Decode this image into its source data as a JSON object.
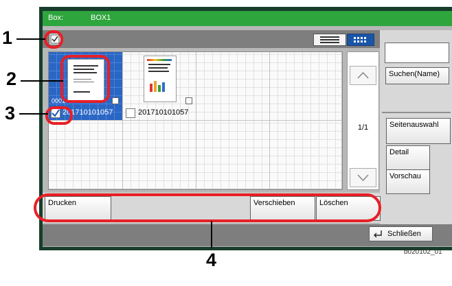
{
  "header": {
    "box_label": "Box:",
    "box_name": "BOX1"
  },
  "files": [
    {
      "name": "201710101057",
      "selected": true,
      "id_prefix": "0001"
    },
    {
      "name": "201710101057",
      "selected": false
    }
  ],
  "pagination": {
    "indicator": "1/1"
  },
  "right_panel": {
    "search_name": "Suchen(Name)",
    "page_selection": "Seitenauswahl",
    "detail": "Detail",
    "preview": "Vorschau"
  },
  "actions": {
    "print": "Drucken",
    "move": "Verschieben",
    "delete": "Löschen"
  },
  "footer": {
    "close": "Schließen",
    "figure_ref": "b020102_01"
  },
  "callouts": [
    "1",
    "2",
    "3",
    "4"
  ],
  "colors": {
    "header": "#2fa53d",
    "selection": "#2a66c4",
    "callout_ring": "#e81f26",
    "frame": "#173d2b"
  },
  "icons": [
    "select-all-checkbox-icon",
    "list-view-icon",
    "thumbnail-view-icon",
    "scroll-up-icon",
    "scroll-down-icon",
    "close-return-icon",
    "document-thumbnail-icon"
  ]
}
